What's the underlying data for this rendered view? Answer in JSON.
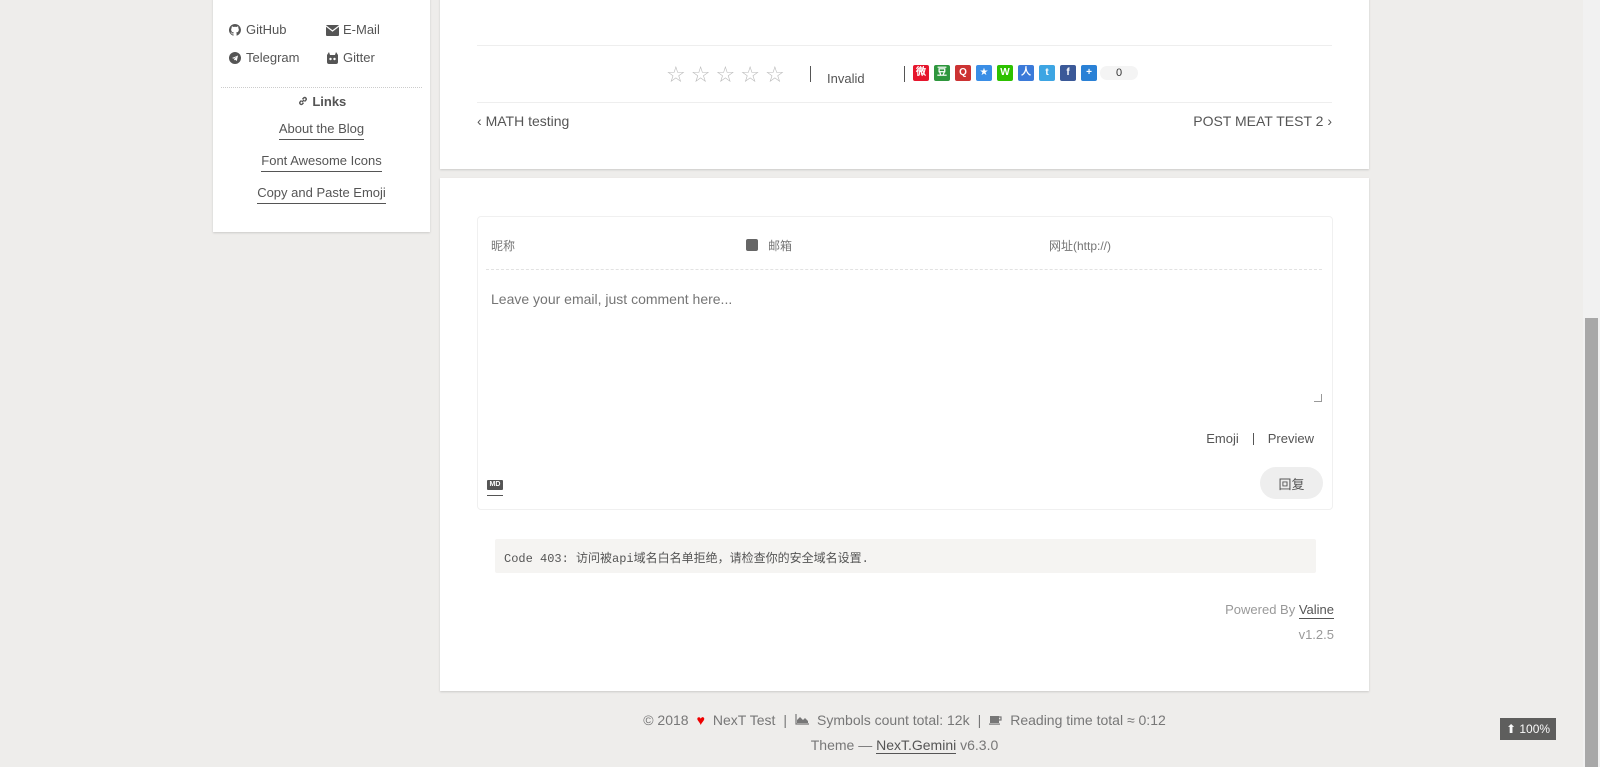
{
  "sidebar": {
    "social": [
      {
        "label": "GitHub",
        "icon": "github-icon"
      },
      {
        "label": "E-Mail",
        "icon": "envelope-icon"
      },
      {
        "label": "Telegram",
        "icon": "telegram-icon"
      },
      {
        "label": "Gitter",
        "icon": "gitter-icon"
      }
    ],
    "links_title": "Links",
    "links": [
      "About the Blog",
      "Font Awesome Icons",
      "Copy and Paste Emoji"
    ]
  },
  "post": {
    "rating_stars": 5,
    "rating_invalid": "Invalid",
    "share_count": "0",
    "prev": "MATH testing",
    "next": "POST MEAT TEST 2"
  },
  "comments": {
    "nick_placeholder": "昵称",
    "mail_placeholder": "邮箱",
    "link_placeholder": "网址(http://)",
    "comment_placeholder": "Leave your email, just comment here...",
    "emoji": "Emoji",
    "preview": "Preview",
    "submit": "回复",
    "md_label": "MD",
    "error": "Code 403: 访问被api域名白名单拒绝，请检查你的安全域名设置.",
    "powered_prefix": "Powered By ",
    "powered_link": "Valine",
    "version": "v1.2.5"
  },
  "footer": {
    "copyright": "© 2018",
    "author": "NexT Test",
    "symbols": "Symbols count total: 12k",
    "reading": "Reading time total ≈ 0:12",
    "theme_prefix": "Theme — ",
    "theme_link": "NexT.Gemini",
    "theme_version": " v6.3.0"
  },
  "back_to_top": "100%"
}
